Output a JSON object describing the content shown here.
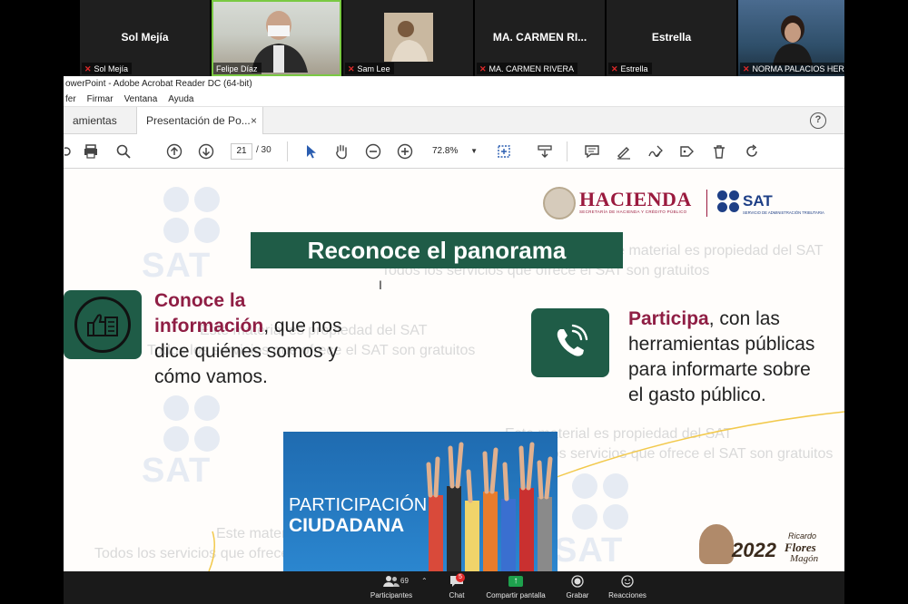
{
  "participants": [
    {
      "display": "Sol Mejía",
      "caption": "Sol Mejía",
      "video": false
    },
    {
      "display": "",
      "caption": "Felipe Díaz",
      "video": true,
      "active": true
    },
    {
      "display": "",
      "caption": "Sam Lee",
      "video": true
    },
    {
      "display": "MA. CARMEN RI...",
      "caption": "MA. CARMEN RIVERA",
      "video": false
    },
    {
      "display": "Estrella",
      "caption": "Estrella",
      "video": false
    },
    {
      "display": "",
      "caption": "NORMA PALACIOS HERN",
      "video": true
    }
  ],
  "acrobat": {
    "window_title": "owerPoint - Adobe Acrobat Reader DC (64-bit)",
    "menu": [
      "fer",
      "Firmar",
      "Ventana",
      "Ayuda"
    ],
    "tabs": {
      "tools": "amientas",
      "doc": "Presentación de Po...",
      "close": "×"
    },
    "help": "?",
    "page_current": "21",
    "page_total": "/ 30",
    "zoom": "72.8%"
  },
  "slide": {
    "logo": {
      "hacienda": "HACIENDA",
      "hacienda_sub": "SECRETARÍA DE HACIENDA Y CRÉDITO PÚBLICO",
      "sat": "SAT",
      "sat_sub": "SERVICIO DE ADMINISTRACIÓN TRIBUTARIA"
    },
    "header": "Reconoce el panorama",
    "left": {
      "em": "Conoce la información",
      "rest": ", que nos dice quiénes somos y cómo vamos."
    },
    "right": {
      "em": "Participa",
      "rest": ", con las herramientas públicas para informarte sobre el gasto público."
    },
    "image_caption_1": "PARTICIPACIÓN",
    "image_caption_2": "CIUDADANA",
    "watermark_line1": "Este material es propiedad del SAT",
    "watermark_line2": "Todos los servicios que ofrece el SAT son gratuitos",
    "watermark_sat": "SAT",
    "anniversary": {
      "year": "2022",
      "ricardo": "Ricardo",
      "flores": "Flores",
      "magon": "Magón"
    }
  },
  "zoom_bar": {
    "participants": {
      "label": "Participantes",
      "count": "69"
    },
    "chat": {
      "label": "Chat",
      "badge": "5"
    },
    "share": {
      "label": "Compartir pantalla"
    },
    "record": {
      "label": "Grabar"
    },
    "reactions": {
      "label": "Reacciones"
    }
  },
  "colors": {
    "green": "#1f5c47",
    "maroon": "#8f1e44",
    "sat_blue": "#1e3f86"
  }
}
